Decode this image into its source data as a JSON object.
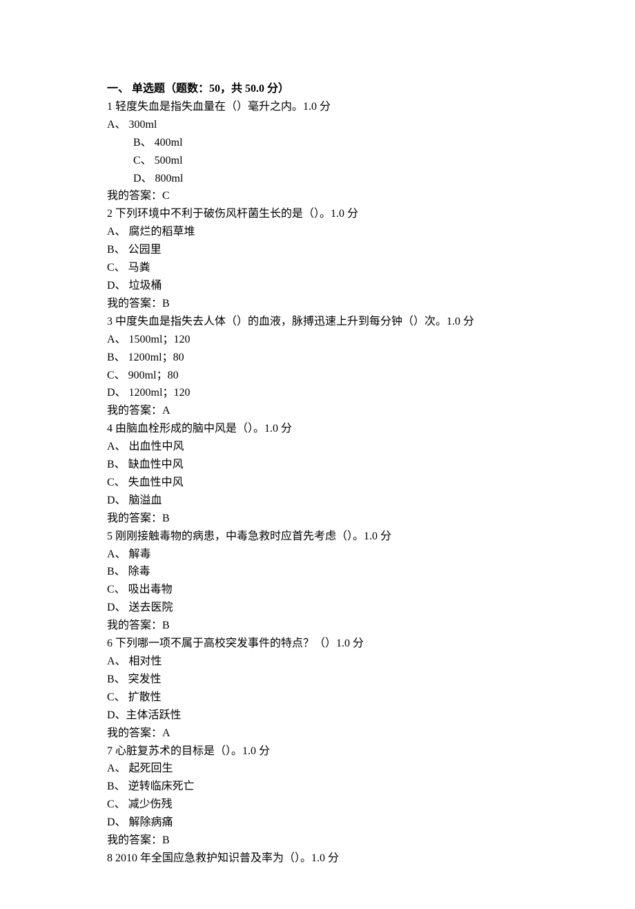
{
  "section": {
    "title": "一、 单选题（题数：50，共 50.0 分）"
  },
  "questions": [
    {
      "q": "1 轻度失血是指失血量在（）毫升之内。1.0 分",
      "options": [
        {
          "text": "A、  300ml",
          "indent": false
        },
        {
          "text": "B、  400ml",
          "indent": true
        },
        {
          "text": "C、  500ml",
          "indent": true
        },
        {
          "text": "D、  800ml",
          "indent": true
        }
      ],
      "answer": "我的答案：C"
    },
    {
      "q": "2 下列环境中不利于破伤风杆菌生长的是（）。1.0 分",
      "options": [
        {
          "text": "A、  腐烂的稻草堆",
          "indent": false
        },
        {
          "text": "B、  公园里",
          "indent": false
        },
        {
          "text": "C、  马粪",
          "indent": false
        },
        {
          "text": "D、  垃圾桶",
          "indent": false
        }
      ],
      "answer": "我的答案：B"
    },
    {
      "q": "3 中度失血是指失去人体（）的血液，脉搏迅速上升到每分钟（）次。1.0 分",
      "options": [
        {
          "text": "A、  1500ml；120",
          "indent": false
        },
        {
          "text": "B、  1200ml；80",
          "indent": false
        },
        {
          "text": "C、  900ml；80",
          "indent": false
        },
        {
          "text": "D、  1200ml；120",
          "indent": false
        }
      ],
      "answer": "我的答案：A"
    },
    {
      "q": "4 由脑血栓形成的脑中风是（）。1.0 分",
      "options": [
        {
          "text": "A、  出血性中风",
          "indent": false
        },
        {
          "text": "B、  缺血性中风",
          "indent": false
        },
        {
          "text": "C、  失血性中风",
          "indent": false
        },
        {
          "text": "D、  脑溢血",
          "indent": false
        }
      ],
      "answer": "我的答案：B"
    },
    {
      "q": "5 刚刚接触毒物的病患，中毒急救时应首先考虑（）。1.0 分",
      "options": [
        {
          "text": "A、  解毒",
          "indent": false
        },
        {
          "text": "B、  除毒",
          "indent": false
        },
        {
          "text": "C、  吸出毒物",
          "indent": false
        },
        {
          "text": "D、  送去医院",
          "indent": false
        }
      ],
      "answer": "我的答案：B"
    },
    {
      "q": "6 下列哪一项不属于高校突发事件的特点？（）1.0 分",
      "options": [
        {
          "text": "A、  相对性",
          "indent": false
        },
        {
          "text": "B、  突发性",
          "indent": false
        },
        {
          "text": "C、  扩散性",
          "indent": false
        },
        {
          "text": "D、主体活跃性",
          "indent": false
        }
      ],
      "answer": "我的答案：A"
    },
    {
      "q": "7 心脏复苏术的目标是（）。1.0 分",
      "options": [
        {
          "text": "A、  起死回生",
          "indent": false
        },
        {
          "text": "B、  逆转临床死亡",
          "indent": false
        },
        {
          "text": "C、  减少伤残",
          "indent": false
        },
        {
          "text": "D、  解除病痛",
          "indent": false
        }
      ],
      "answer": "我的答案：B"
    },
    {
      "q": "8 2010 年全国应急救护知识普及率为（）。1.0 分",
      "options": [],
      "answer": ""
    }
  ]
}
